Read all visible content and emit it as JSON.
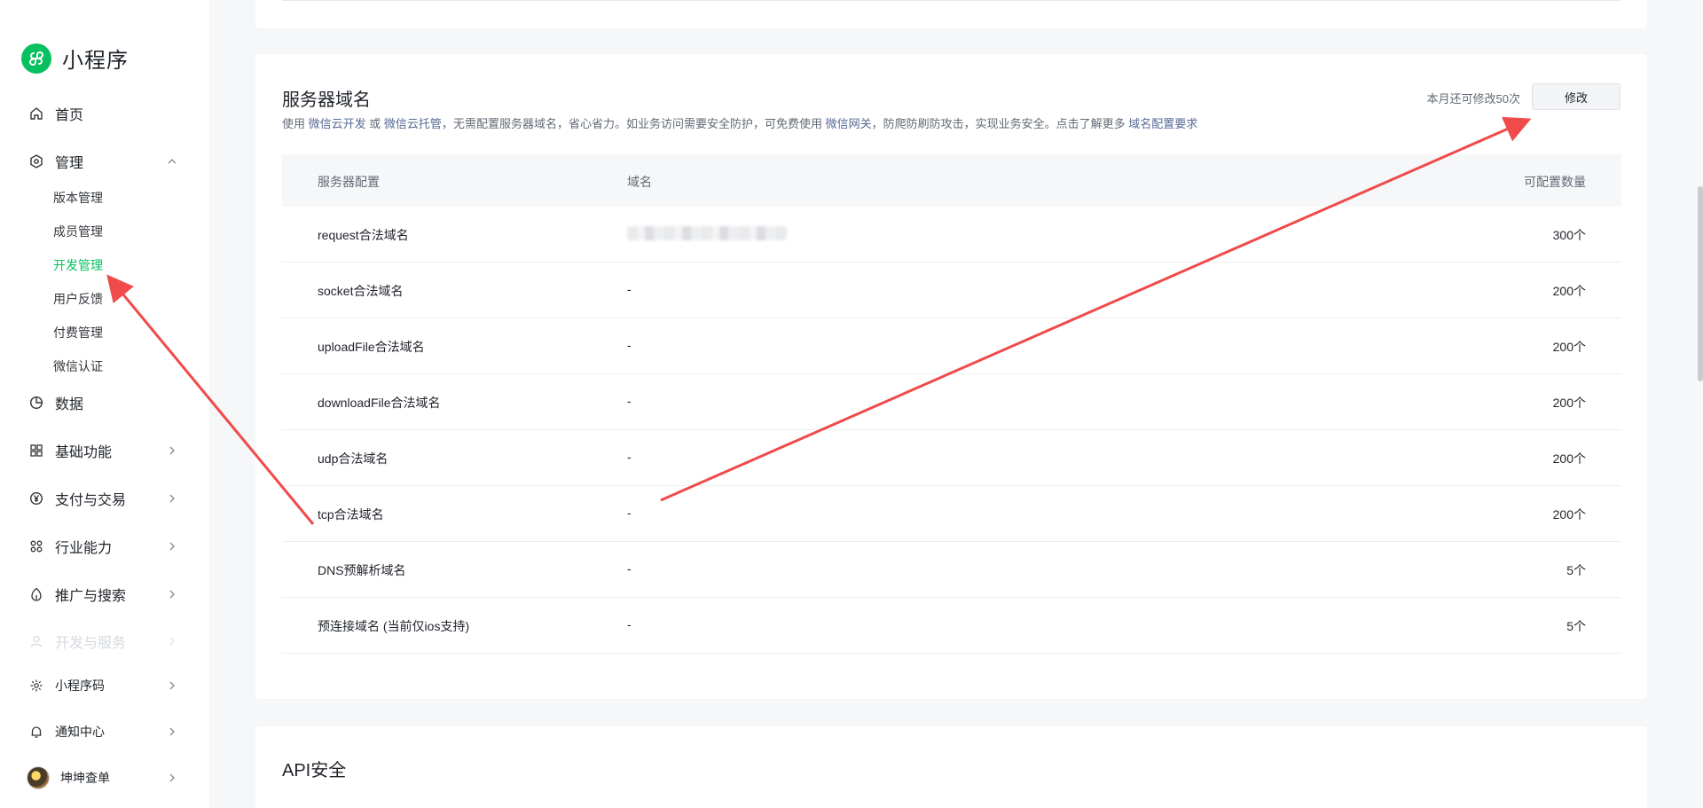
{
  "app": {
    "name": "小程序",
    "logo_icon": "mini-program-logo-icon",
    "brand_color": "#07c160"
  },
  "sidebar": {
    "items": [
      {
        "label": "首页",
        "icon": "home-icon"
      },
      {
        "label": "管理",
        "icon": "settings-icon",
        "expanded": true
      },
      {
        "label": "数据",
        "icon": "chart-pie-icon"
      },
      {
        "label": "基础功能",
        "icon": "grid-icon"
      },
      {
        "label": "支付与交易",
        "icon": "yen-icon"
      },
      {
        "label": "行业能力",
        "icon": "industry-icon"
      },
      {
        "label": "推广与搜索",
        "icon": "promote-icon"
      },
      {
        "label": "开发与服务",
        "icon": "dev-icon"
      },
      {
        "label": "小程序码",
        "icon": "code-icon"
      },
      {
        "label": "通知中心",
        "icon": "bell-icon"
      },
      {
        "label": "坤坤查单",
        "icon": "avatar"
      }
    ],
    "sub_items": [
      {
        "label": "版本管理"
      },
      {
        "label": "成员管理"
      },
      {
        "label": "开发管理",
        "active": true
      },
      {
        "label": "用户反馈"
      },
      {
        "label": "付费管理"
      },
      {
        "label": "微信认证"
      }
    ]
  },
  "server_domain": {
    "title": "服务器域名",
    "desc_prefix": "使用",
    "link_cloud_dev": "微信云开发",
    "desc_or": "或",
    "link_cloud_host": "微信云托管",
    "desc_mid": "，无需配置服务器域名，省心省力。如业务访问需要安全防护，可免费使用",
    "link_gateway": "微信网关",
    "desc_end": "，防爬防刷防攻击，实现业务安全。点击了解更多",
    "link_requirements": "域名配置要求",
    "quota_text": "本月还可修改50次",
    "edit_button": "修改",
    "columns": [
      "服务器配置",
      "域名",
      "可配置数量"
    ],
    "rows": [
      {
        "config": "request合法域名",
        "domain": "",
        "count": "300个"
      },
      {
        "config": "socket合法域名",
        "domain": "-",
        "count": "200个"
      },
      {
        "config": "uploadFile合法域名",
        "domain": "-",
        "count": "200个"
      },
      {
        "config": "downloadFile合法域名",
        "domain": "-",
        "count": "200个"
      },
      {
        "config": "udp合法域名",
        "domain": "-",
        "count": "200个"
      },
      {
        "config": "tcp合法域名",
        "domain": "-",
        "count": "200个"
      },
      {
        "config": "DNS预解析域名",
        "domain": "-",
        "count": "5个"
      },
      {
        "config": "预连接域名 (当前仅ios支持)",
        "domain": "-",
        "count": "5个"
      }
    ]
  },
  "api_security": {
    "title": "API安全"
  },
  "annotation_color": "#f04a4a"
}
